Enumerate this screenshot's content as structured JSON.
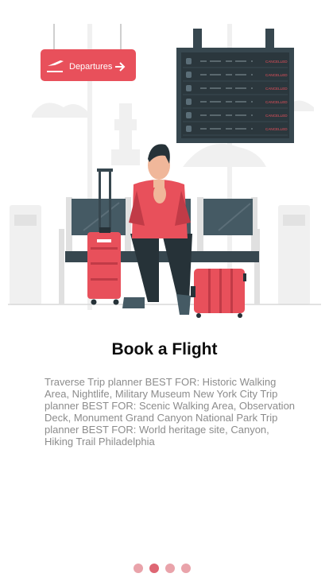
{
  "illustration": {
    "sign_text": "Departures",
    "board_status": [
      "CANCELLED",
      "CANCELLED",
      "CANCELLED",
      "CANCELLED",
      "CANCELLED",
      "CANCELLED"
    ]
  },
  "title": "Book a Flight",
  "description": "Traverse Trip planner BEST FOR: Historic Walking Area, Nightlife, Military Museum New York City Trip planner BEST FOR: Scenic Walking Area, Observation Deck, Monument Grand Canyon National Park Trip planner BEST FOR: World heritage site, Canyon, Hiking Trail Philadelphia",
  "pagination": {
    "total": 4,
    "current": 2
  },
  "colors": {
    "accent": "#e8505b",
    "board": "#37474f",
    "dot_active": "#de6673",
    "dot_inactive": "#e9a3aa"
  }
}
